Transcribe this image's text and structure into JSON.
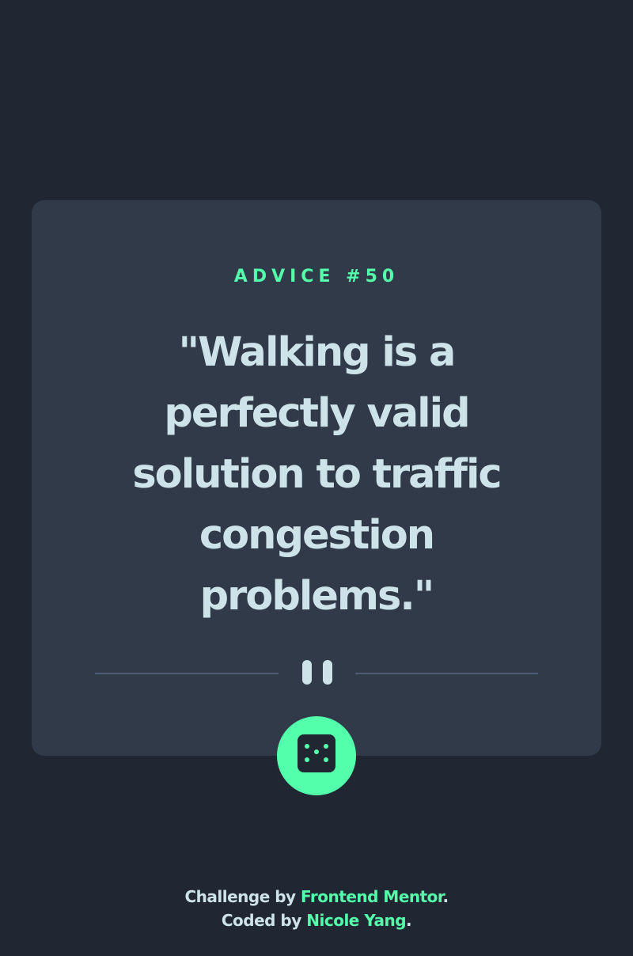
{
  "advice": {
    "title": "ADVICE #50",
    "quote": "\"Walking is a perfectly valid solution to traffic congestion problems.\""
  },
  "divider": {
    "icon": "pause-icon"
  },
  "generate_button": {
    "icon": "dice-icon"
  },
  "footer": {
    "challenge_prefix": "Challenge by ",
    "challenge_link": "Frontend Mentor",
    "challenge_suffix": ".",
    "coded_prefix": "Coded by ",
    "coded_link": "Nicole Yang",
    "coded_suffix": "."
  },
  "colors": {
    "background": "#202632",
    "card": "#313a48",
    "accent": "#53ffaa",
    "text": "#cee3e9",
    "divider": "#4e5d73"
  }
}
